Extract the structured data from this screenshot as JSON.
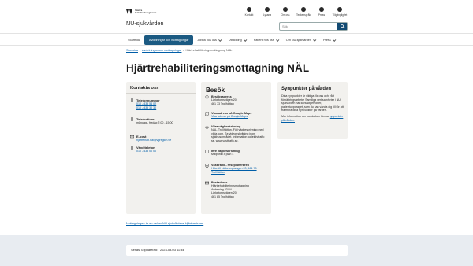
{
  "header": {
    "logo_line1": "Västra",
    "logo_line2": "Götalandsregionen",
    "org_name": "NU-sjukvården",
    "util_nav": [
      {
        "label": "Kontakt",
        "icon": "phone-icon"
      },
      {
        "label": "Lyssna",
        "icon": "speaker-icon"
      },
      {
        "label": "Om oss",
        "icon": "info-icon"
      },
      {
        "label": "Teckenspråk",
        "icon": "sign-language-icon"
      },
      {
        "label": "Press",
        "icon": "press-icon"
      },
      {
        "label": "Tillgänglighet",
        "icon": "accessibility-icon"
      }
    ],
    "search_placeholder": "Sök"
  },
  "nav": {
    "items": [
      {
        "label": "Startsida",
        "dropdown": false,
        "active": false
      },
      {
        "label": "Avdelningar och mottagningar",
        "dropdown": false,
        "active": true
      },
      {
        "label": "Jobba hos oss",
        "dropdown": true,
        "active": false
      },
      {
        "label": "Utbildning",
        "dropdown": true,
        "active": false
      },
      {
        "label": "Patient hos oss",
        "dropdown": true,
        "active": false
      },
      {
        "label": "Om NU-sjukvården",
        "dropdown": true,
        "active": false
      },
      {
        "label": "Press",
        "dropdown": true,
        "active": false
      }
    ]
  },
  "breadcrumb": {
    "home": "Startsida",
    "sep": "/",
    "section": "Avdelningar och mottagningar",
    "current": "Hjärtrehabiliteringsmottagning NÄL"
  },
  "page_title": "Hjärtrehabiliteringsmottagning NÄL",
  "contact": {
    "heading": "Kontakta oss",
    "phone_title": "Telefonnummer",
    "phone1": "010 - 435 54 02",
    "phone2": "010 - 435 30 30",
    "hours_title": "Telefontider",
    "hours": "måndag - fredag 7:00 - 15:00",
    "email_title": "E-post",
    "email": "hjartrehab.nal@vgregion.se",
    "switch_title": "Växeltelefon",
    "switch": "010 - 435 00 00"
  },
  "visit": {
    "heading": "Besök",
    "address_title": "Besöksadress",
    "address1": "Lärketorpsvägen 20",
    "address2": "461 73 Trollhättan",
    "maps_title": "Visa adress på Google Maps",
    "maps_link": "Visa adress på Google Maps",
    "walk_title": "Vitra vägbeskrivning",
    "walk_text": "NÄL, Trollhättan. Följ vägbeskrivning med vilda kom. Se videor skyltning inom sjukhusområdet. Information kollektivtrafik: se. www.vasttrafik.se.",
    "inner_title": "Inre vägbeskrivning",
    "inner_text": "Målpunkt 4 plan 4",
    "transit_title": "Västtrafik - reseplaneraren",
    "transit_link": "Hitta till Lärketorpsvägen 20, 461 73 Trollhättan",
    "post_title": "Postadress",
    "post1": "Hjärtrehabiliteringsmottagning",
    "post2": "Avdelning 43/44",
    "post3": "Lärketorpsvägen 20",
    "post4": "461 85 Trollhättan"
  },
  "feedback": {
    "heading": "Synpunkter på vården",
    "text1": "Dina synpunkter är viktiga för oss och vårt förbättringsarbete. Samtliga verksamheter i NU-sjukvården har kontaktpersoner, patientuppdraget, som du kan vända dig till för att framföra dina synpunkter på vården.",
    "text2_prefix": "Mer information om hur du kan lämna",
    "text2_link": "synpunkter på vården."
  },
  "more_link": "Mottagningen är en del av NU-sjukvårdens Hjärtcentrum.",
  "footer": {
    "updated_label": "Senast uppdaterad:",
    "updated_value": "2023-08-03 11:34"
  },
  "colors": {
    "primary": "#1b5a82",
    "link": "#005ea8",
    "card_bg": "#f2f1ee",
    "footer_bg": "#e8ecf1"
  }
}
